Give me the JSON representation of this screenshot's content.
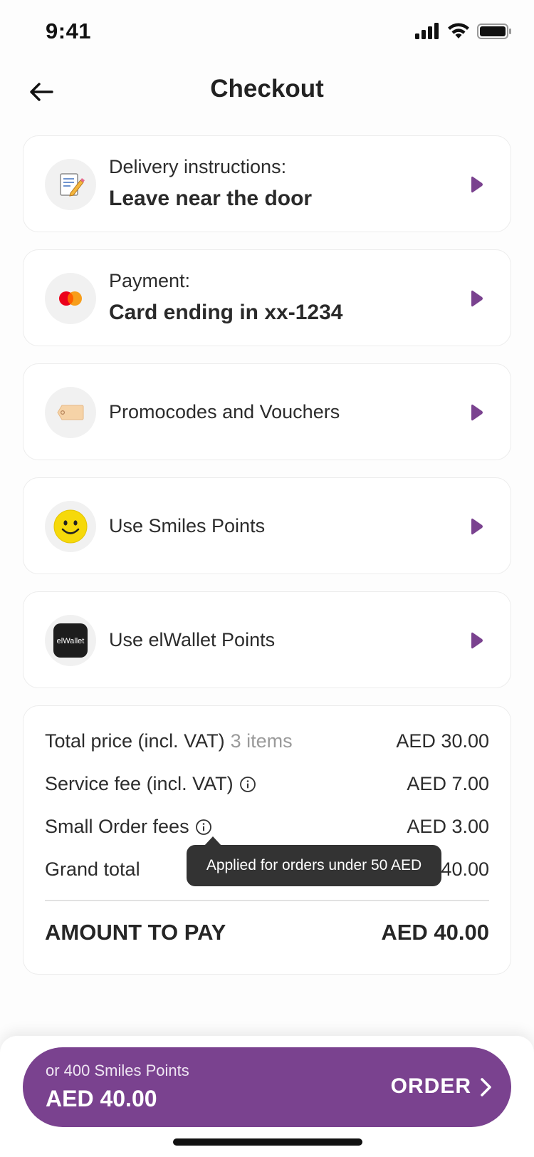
{
  "status_bar": {
    "time": "9:41"
  },
  "header": {
    "title": "Checkout"
  },
  "options": [
    {
      "label": "Delivery instructions:",
      "value": "Leave near the door",
      "icon": "memo-pencil-icon"
    },
    {
      "label": "Payment:",
      "value": "Card ending in xx-1234",
      "icon": "mastercard-icon"
    },
    {
      "label": "Promocodes and Vouchers",
      "icon": "tag-icon"
    },
    {
      "label": "Use Smiles Points",
      "icon": "smiley-icon"
    },
    {
      "label": "Use elWallet Points",
      "icon": "elwallet-logo",
      "logo_text": "elWallet"
    }
  ],
  "summary": {
    "total_price_label": "Total price (incl. VAT)",
    "items_count": "3 items",
    "total_price_value": "AED 30.00",
    "service_fee_label": "Service fee (incl. VAT)",
    "service_fee_value": "AED 7.00",
    "small_order_label": "Small Order fees",
    "small_order_value": "AED 3.00",
    "grand_total_label": "Grand total",
    "grand_total_value": "AED 40.00",
    "amount_to_pay_label": "AMOUNT TO PAY",
    "amount_to_pay_value": "AED 40.00"
  },
  "tooltip": {
    "text": "Applied for orders under 50 AED"
  },
  "order": {
    "points_text": "or 400 Smiles Points",
    "amount": "AED 40.00",
    "label": "ORDER"
  },
  "colors": {
    "accent": "#7a428f",
    "tooltip_bg": "#333333"
  }
}
